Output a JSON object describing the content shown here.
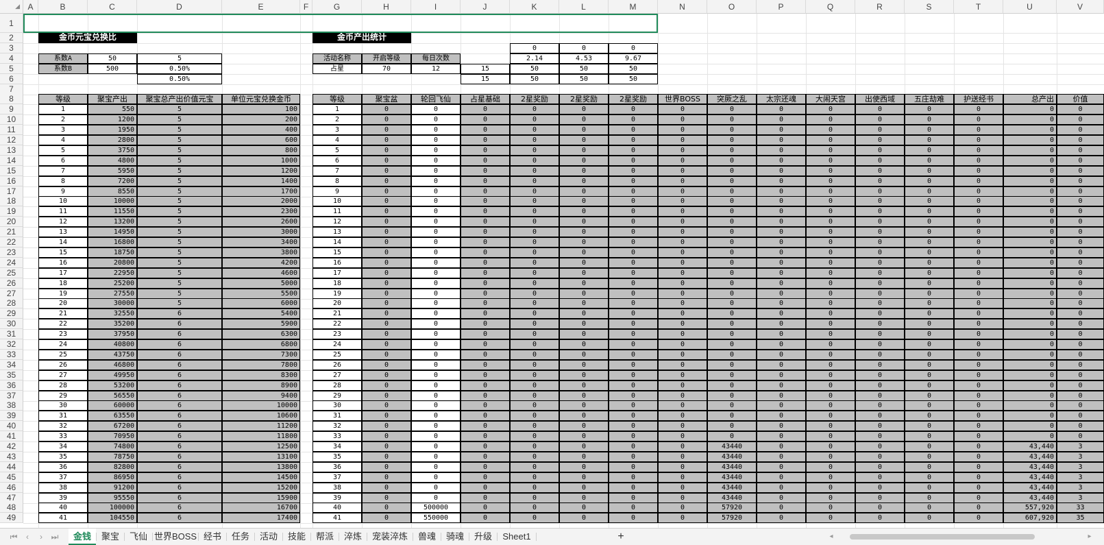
{
  "sheet": {
    "columns": [
      "A",
      "B",
      "C",
      "D",
      "E",
      "F",
      "G",
      "H",
      "I",
      "J",
      "K",
      "L",
      "M",
      "N",
      "O",
      "P",
      "Q",
      "R",
      "S",
      "T",
      "U",
      "V"
    ],
    "rows": [
      "1",
      "2",
      "3",
      "4",
      "5",
      "6",
      "7",
      "8",
      "9",
      "10",
      "11",
      "12",
      "13",
      "14",
      "15",
      "16",
      "17",
      "18",
      "19",
      "20",
      "21",
      "22",
      "23",
      "24",
      "25",
      "26",
      "27",
      "28",
      "29",
      "30",
      "31",
      "32",
      "33",
      "34",
      "35",
      "36",
      "37",
      "38",
      "39",
      "40",
      "41",
      "42",
      "43",
      "44",
      "45",
      "46",
      "47",
      "48",
      "49"
    ],
    "title_left": "金币元宝兑换比",
    "title_right": "金币产出统计",
    "coef": {
      "a_label": "系数A",
      "a_val": "50",
      "a_val2": "5",
      "b_label": "系数B",
      "b_val": "500",
      "b_val2": "0.50%",
      "c_val2": "0.50%"
    },
    "activity": {
      "headers": [
        "活动名称",
        "开启等级",
        "每日次数"
      ],
      "row": [
        "占星",
        "70",
        "12",
        "15"
      ],
      "row6_j": "15",
      "k3": [
        "0",
        "0",
        "0"
      ],
      "k4": [
        "2.14",
        "4.53",
        "9.67"
      ],
      "k5": [
        "50",
        "50",
        "50"
      ],
      "k6": [
        "50",
        "50",
        "50"
      ]
    },
    "left_headers": [
      "等级",
      "聚宝产出",
      "聚宝总产出价值元宝",
      "单位元宝兑换金币"
    ],
    "right_headers": [
      "等级",
      "聚宝盆",
      "轮回飞仙",
      "占星基础",
      "2星奖励",
      "2星奖励",
      "2星奖励",
      "世界BOSS",
      "突厥之乱",
      "太宗还魂",
      "大闹天宫",
      "出使西域",
      "五庄劫难",
      "护送经书",
      "总产出",
      "价值"
    ],
    "left_rows": [
      [
        "1",
        "550",
        "5",
        "100"
      ],
      [
        "2",
        "1200",
        "5",
        "200"
      ],
      [
        "3",
        "1950",
        "5",
        "400"
      ],
      [
        "4",
        "2800",
        "5",
        "600"
      ],
      [
        "5",
        "3750",
        "5",
        "800"
      ],
      [
        "6",
        "4800",
        "5",
        "1000"
      ],
      [
        "7",
        "5950",
        "5",
        "1200"
      ],
      [
        "8",
        "7200",
        "5",
        "1400"
      ],
      [
        "9",
        "8550",
        "5",
        "1700"
      ],
      [
        "10",
        "10000",
        "5",
        "2000"
      ],
      [
        "11",
        "11550",
        "5",
        "2300"
      ],
      [
        "12",
        "13200",
        "5",
        "2600"
      ],
      [
        "13",
        "14950",
        "5",
        "3000"
      ],
      [
        "14",
        "16800",
        "5",
        "3400"
      ],
      [
        "15",
        "18750",
        "5",
        "3800"
      ],
      [
        "16",
        "20800",
        "5",
        "4200"
      ],
      [
        "17",
        "22950",
        "5",
        "4600"
      ],
      [
        "18",
        "25200",
        "5",
        "5000"
      ],
      [
        "19",
        "27550",
        "5",
        "5500"
      ],
      [
        "20",
        "30000",
        "5",
        "6000"
      ],
      [
        "21",
        "32550",
        "6",
        "5400"
      ],
      [
        "22",
        "35200",
        "6",
        "5900"
      ],
      [
        "23",
        "37950",
        "6",
        "6300"
      ],
      [
        "24",
        "40800",
        "6",
        "6800"
      ],
      [
        "25",
        "43750",
        "6",
        "7300"
      ],
      [
        "26",
        "46800",
        "6",
        "7800"
      ],
      [
        "27",
        "49950",
        "6",
        "8300"
      ],
      [
        "28",
        "53200",
        "6",
        "8900"
      ],
      [
        "29",
        "56550",
        "6",
        "9400"
      ],
      [
        "30",
        "60000",
        "6",
        "10000"
      ],
      [
        "31",
        "63550",
        "6",
        "10600"
      ],
      [
        "32",
        "67200",
        "6",
        "11200"
      ],
      [
        "33",
        "70950",
        "6",
        "11800"
      ],
      [
        "34",
        "74800",
        "6",
        "12500"
      ],
      [
        "35",
        "78750",
        "6",
        "13100"
      ],
      [
        "36",
        "82800",
        "6",
        "13800"
      ],
      [
        "37",
        "86950",
        "6",
        "14500"
      ],
      [
        "38",
        "91200",
        "6",
        "15200"
      ],
      [
        "39",
        "95550",
        "6",
        "15900"
      ],
      [
        "40",
        "100000",
        "6",
        "16700"
      ],
      [
        "41",
        "104550",
        "6",
        "17400"
      ]
    ],
    "right_special": {
      "34": {
        "o": "43440",
        "u": "43,440",
        "v": "3"
      },
      "35": {
        "o": "43440",
        "u": "43,440",
        "v": "3"
      },
      "36": {
        "o": "43440",
        "u": "43,440",
        "v": "3"
      },
      "37": {
        "o": "43440",
        "u": "43,440",
        "v": "3"
      },
      "38": {
        "o": "43440",
        "u": "43,440",
        "v": "3"
      },
      "39": {
        "o": "43440",
        "u": "43,440",
        "v": "3"
      },
      "40": {
        "i": "500000",
        "o": "57920",
        "u": "557,920",
        "v": "33"
      },
      "41": {
        "i": "550000",
        "o": "57920",
        "u": "607,920",
        "v": "35"
      }
    },
    "zero": "0"
  },
  "tabs": [
    "金钱",
    "聚宝",
    "飞仙",
    "世界BOSS",
    "经书",
    "任务",
    "活动",
    "技能",
    "帮派",
    "淬炼",
    "宠装淬炼",
    "兽魂",
    "骑魂",
    "升级",
    "Sheet1"
  ],
  "add_tab": "+",
  "colors": {
    "selection": "#1f8a5a",
    "header_fill": "#c0c0c0",
    "title_fill": "#000000"
  }
}
